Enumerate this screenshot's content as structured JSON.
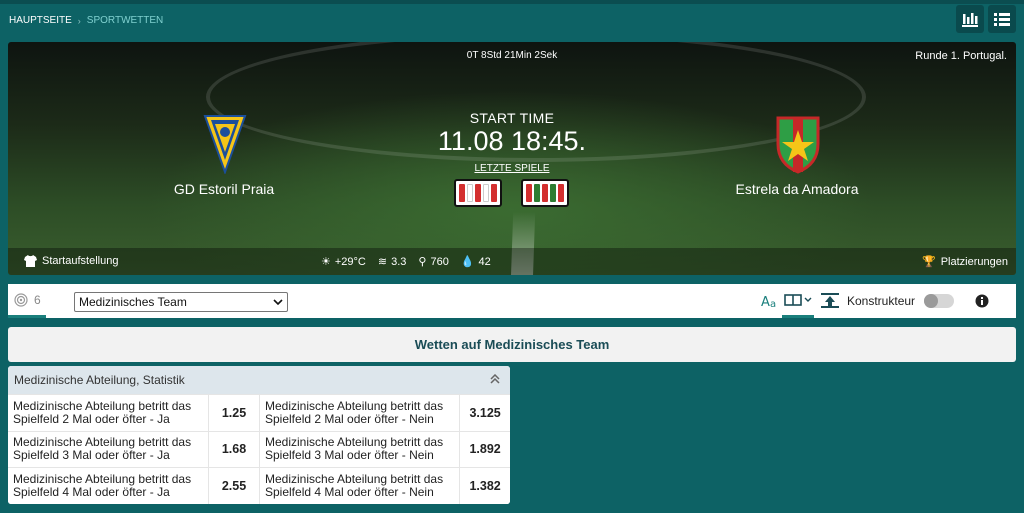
{
  "breadcrumb": {
    "home": "HAUPTSEITE",
    "current": "SPORTWETTEN"
  },
  "header_buttons": [
    {
      "icon": "bar-chart-icon"
    },
    {
      "icon": "list-icon"
    }
  ],
  "match": {
    "countdown": "0T 8Std 21Min 2Sek",
    "round": "Runde 1. Portugal.",
    "start_label": "START TIME",
    "start_time": "11.08 18:45.",
    "last_games_label": "LETZTE SPIELE",
    "home": {
      "name": "GD Estoril Praia",
      "form": [
        "#d32f2f",
        "#ffffff",
        "#d32f2f",
        "#ffffff",
        "#d32f2f"
      ]
    },
    "away": {
      "name": "Estrela da Amadora",
      "form": [
        "#d32f2f",
        "#2e7d32",
        "#d32f2f",
        "#2e7d32",
        "#d32f2f"
      ]
    },
    "lineup_label": "Startaufstellung",
    "placements_label": "Platzierungen",
    "weather": {
      "temp": "+29°C",
      "wind": "3.3",
      "pressure": "760",
      "humidity": "42"
    }
  },
  "filter": {
    "count": "6",
    "select_value": "Medizinisches Team",
    "constructor_label": "Konstrukteur"
  },
  "bets_title": "Wetten auf Medizinisches Team",
  "market": {
    "title": "Medizinische Abteilung, Statistik",
    "rows": [
      {
        "yes_label": "Medizinische Abteilung betritt das Spielfeld 2 Mal oder öfter - Ja",
        "yes_odd": "1.25",
        "no_label": "Medizinische Abteilung betritt das Spielfeld 2 Mal oder öfter - Nein",
        "no_odd": "3.125"
      },
      {
        "yes_label": "Medizinische Abteilung betritt das Spielfeld 3 Mal oder öfter - Ja",
        "yes_odd": "1.68",
        "no_label": "Medizinische Abteilung betritt das Spielfeld 3 Mal oder öfter - Nein",
        "no_odd": "1.892"
      },
      {
        "yes_label": "Medizinische Abteilung betritt das Spielfeld 4 Mal oder öfter - Ja",
        "yes_odd": "2.55",
        "no_label": "Medizinische Abteilung betritt das Spielfeld 4 Mal oder öfter - Nein",
        "no_odd": "1.382"
      }
    ]
  },
  "colors": {
    "background": "#0d6265",
    "accent": "#1a7f7c",
    "header_text": "#1a4c56"
  }
}
